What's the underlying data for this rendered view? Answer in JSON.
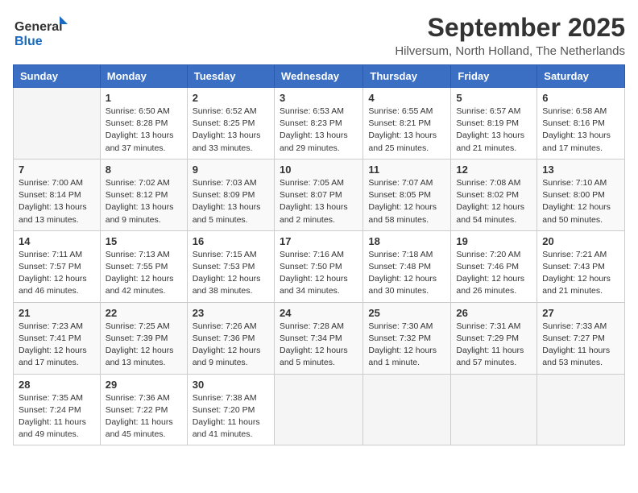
{
  "header": {
    "logo_general": "General",
    "logo_blue": "Blue",
    "month_title": "September 2025",
    "location": "Hilversum, North Holland, The Netherlands"
  },
  "calendar": {
    "headers": [
      "Sunday",
      "Monday",
      "Tuesday",
      "Wednesday",
      "Thursday",
      "Friday",
      "Saturday"
    ],
    "weeks": [
      [
        {
          "day": "",
          "info": ""
        },
        {
          "day": "1",
          "info": "Sunrise: 6:50 AM\nSunset: 8:28 PM\nDaylight: 13 hours\nand 37 minutes."
        },
        {
          "day": "2",
          "info": "Sunrise: 6:52 AM\nSunset: 8:25 PM\nDaylight: 13 hours\nand 33 minutes."
        },
        {
          "day": "3",
          "info": "Sunrise: 6:53 AM\nSunset: 8:23 PM\nDaylight: 13 hours\nand 29 minutes."
        },
        {
          "day": "4",
          "info": "Sunrise: 6:55 AM\nSunset: 8:21 PM\nDaylight: 13 hours\nand 25 minutes."
        },
        {
          "day": "5",
          "info": "Sunrise: 6:57 AM\nSunset: 8:19 PM\nDaylight: 13 hours\nand 21 minutes."
        },
        {
          "day": "6",
          "info": "Sunrise: 6:58 AM\nSunset: 8:16 PM\nDaylight: 13 hours\nand 17 minutes."
        }
      ],
      [
        {
          "day": "7",
          "info": "Sunrise: 7:00 AM\nSunset: 8:14 PM\nDaylight: 13 hours\nand 13 minutes."
        },
        {
          "day": "8",
          "info": "Sunrise: 7:02 AM\nSunset: 8:12 PM\nDaylight: 13 hours\nand 9 minutes."
        },
        {
          "day": "9",
          "info": "Sunrise: 7:03 AM\nSunset: 8:09 PM\nDaylight: 13 hours\nand 5 minutes."
        },
        {
          "day": "10",
          "info": "Sunrise: 7:05 AM\nSunset: 8:07 PM\nDaylight: 13 hours\nand 2 minutes."
        },
        {
          "day": "11",
          "info": "Sunrise: 7:07 AM\nSunset: 8:05 PM\nDaylight: 12 hours\nand 58 minutes."
        },
        {
          "day": "12",
          "info": "Sunrise: 7:08 AM\nSunset: 8:02 PM\nDaylight: 12 hours\nand 54 minutes."
        },
        {
          "day": "13",
          "info": "Sunrise: 7:10 AM\nSunset: 8:00 PM\nDaylight: 12 hours\nand 50 minutes."
        }
      ],
      [
        {
          "day": "14",
          "info": "Sunrise: 7:11 AM\nSunset: 7:57 PM\nDaylight: 12 hours\nand 46 minutes."
        },
        {
          "day": "15",
          "info": "Sunrise: 7:13 AM\nSunset: 7:55 PM\nDaylight: 12 hours\nand 42 minutes."
        },
        {
          "day": "16",
          "info": "Sunrise: 7:15 AM\nSunset: 7:53 PM\nDaylight: 12 hours\nand 38 minutes."
        },
        {
          "day": "17",
          "info": "Sunrise: 7:16 AM\nSunset: 7:50 PM\nDaylight: 12 hours\nand 34 minutes."
        },
        {
          "day": "18",
          "info": "Sunrise: 7:18 AM\nSunset: 7:48 PM\nDaylight: 12 hours\nand 30 minutes."
        },
        {
          "day": "19",
          "info": "Sunrise: 7:20 AM\nSunset: 7:46 PM\nDaylight: 12 hours\nand 26 minutes."
        },
        {
          "day": "20",
          "info": "Sunrise: 7:21 AM\nSunset: 7:43 PM\nDaylight: 12 hours\nand 21 minutes."
        }
      ],
      [
        {
          "day": "21",
          "info": "Sunrise: 7:23 AM\nSunset: 7:41 PM\nDaylight: 12 hours\nand 17 minutes."
        },
        {
          "day": "22",
          "info": "Sunrise: 7:25 AM\nSunset: 7:39 PM\nDaylight: 12 hours\nand 13 minutes."
        },
        {
          "day": "23",
          "info": "Sunrise: 7:26 AM\nSunset: 7:36 PM\nDaylight: 12 hours\nand 9 minutes."
        },
        {
          "day": "24",
          "info": "Sunrise: 7:28 AM\nSunset: 7:34 PM\nDaylight: 12 hours\nand 5 minutes."
        },
        {
          "day": "25",
          "info": "Sunrise: 7:30 AM\nSunset: 7:32 PM\nDaylight: 12 hours\nand 1 minute."
        },
        {
          "day": "26",
          "info": "Sunrise: 7:31 AM\nSunset: 7:29 PM\nDaylight: 11 hours\nand 57 minutes."
        },
        {
          "day": "27",
          "info": "Sunrise: 7:33 AM\nSunset: 7:27 PM\nDaylight: 11 hours\nand 53 minutes."
        }
      ],
      [
        {
          "day": "28",
          "info": "Sunrise: 7:35 AM\nSunset: 7:24 PM\nDaylight: 11 hours\nand 49 minutes."
        },
        {
          "day": "29",
          "info": "Sunrise: 7:36 AM\nSunset: 7:22 PM\nDaylight: 11 hours\nand 45 minutes."
        },
        {
          "day": "30",
          "info": "Sunrise: 7:38 AM\nSunset: 7:20 PM\nDaylight: 11 hours\nand 41 minutes."
        },
        {
          "day": "",
          "info": ""
        },
        {
          "day": "",
          "info": ""
        },
        {
          "day": "",
          "info": ""
        },
        {
          "day": "",
          "info": ""
        }
      ]
    ]
  }
}
